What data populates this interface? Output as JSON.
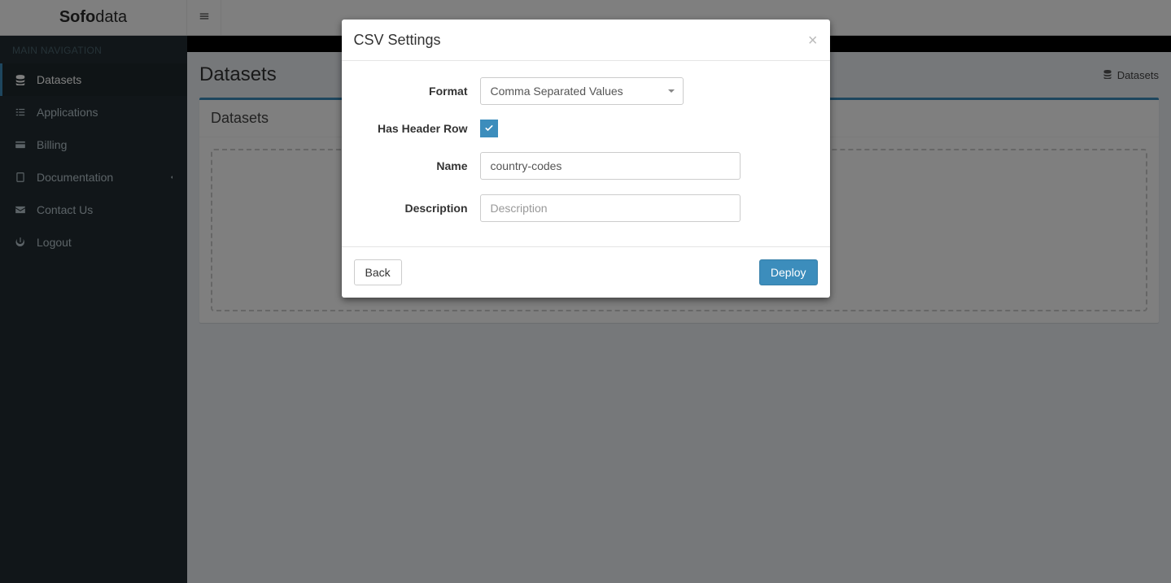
{
  "brand": {
    "bold": "Sofo",
    "light": "data"
  },
  "sidebar": {
    "section": "MAIN NAVIGATION",
    "items": [
      {
        "label": "Datasets"
      },
      {
        "label": "Applications"
      },
      {
        "label": "Billing"
      },
      {
        "label": "Documentation"
      },
      {
        "label": "Contact Us"
      },
      {
        "label": "Logout"
      }
    ]
  },
  "page": {
    "title": "Datasets",
    "breadcrumb": "Datasets",
    "panel_title": "Datasets"
  },
  "modal": {
    "title": "CSV Settings",
    "labels": {
      "format": "Format",
      "has_header": "Has Header Row",
      "name": "Name",
      "description": "Description"
    },
    "values": {
      "format": "Comma Separated Values",
      "has_header": true,
      "name": "country-codes",
      "description": ""
    },
    "placeholders": {
      "description": "Description"
    },
    "buttons": {
      "back": "Back",
      "deploy": "Deploy"
    }
  }
}
